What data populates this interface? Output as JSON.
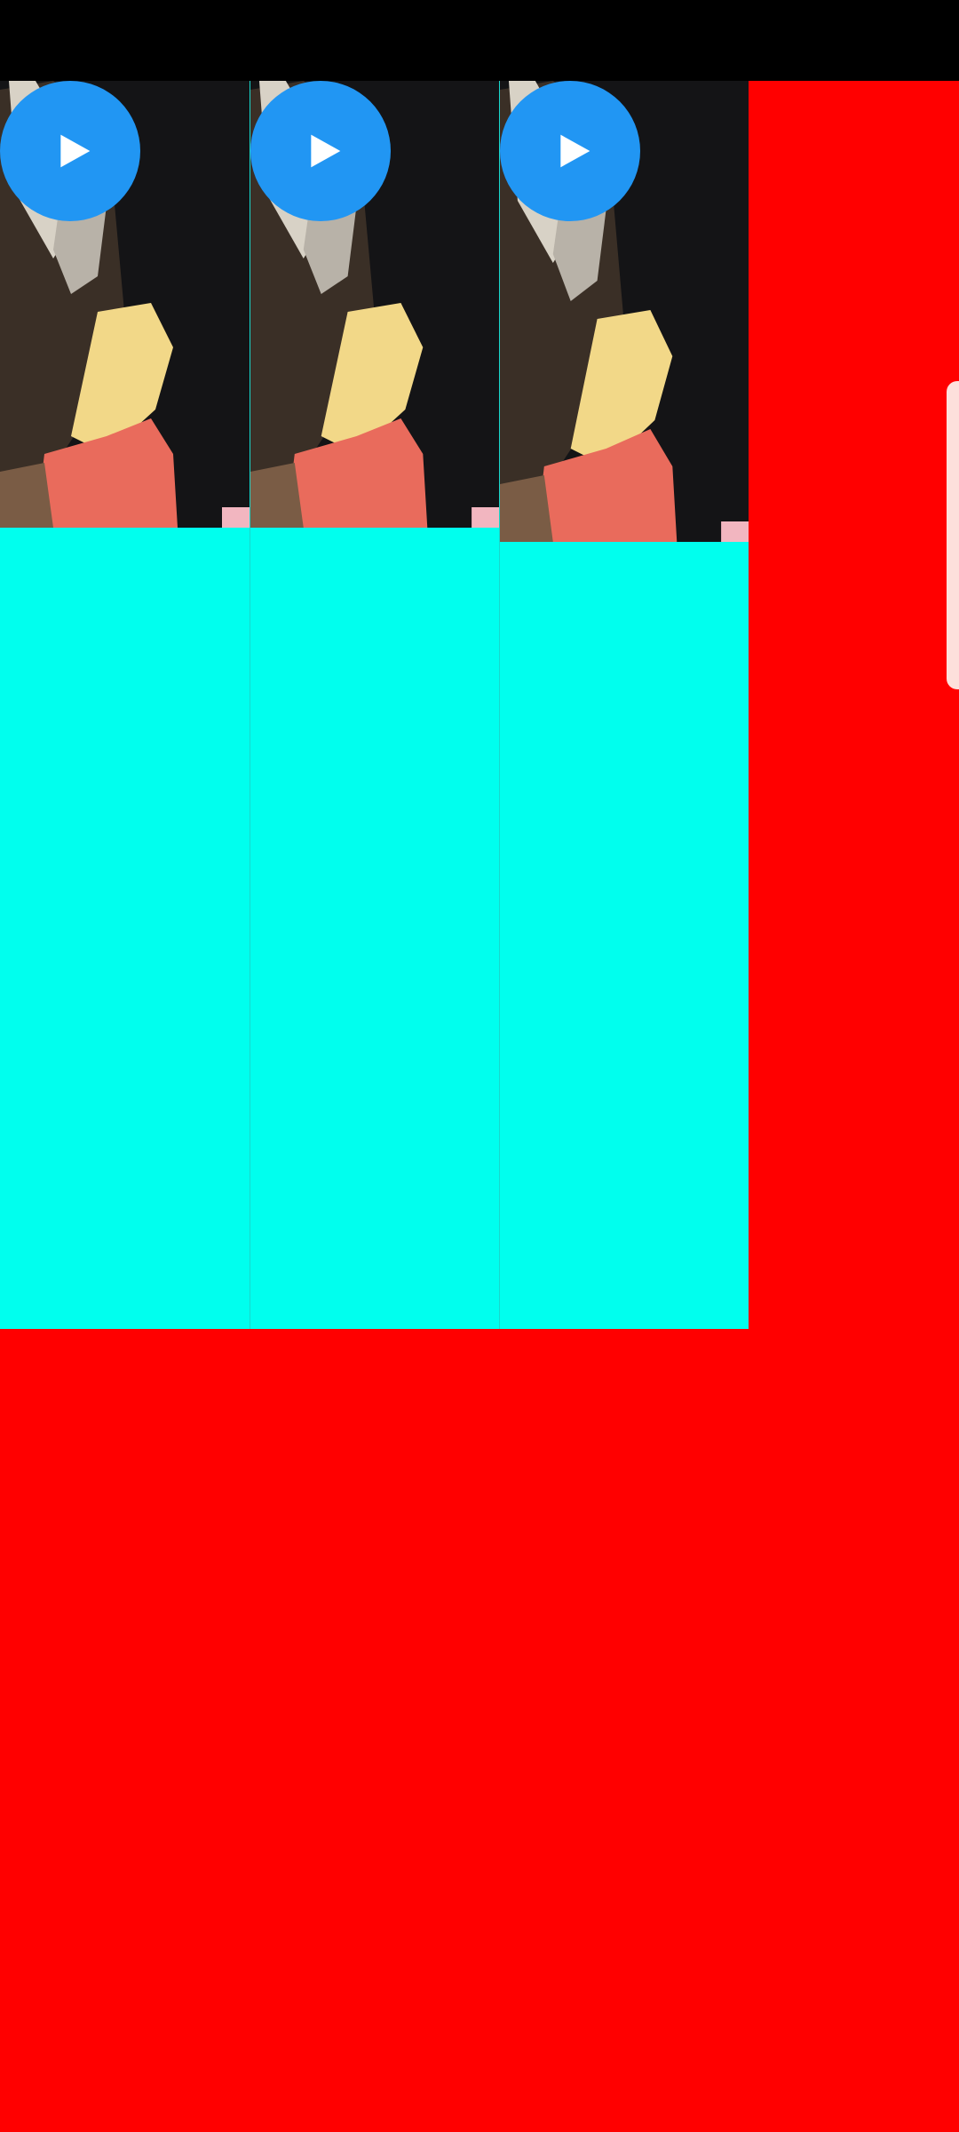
{
  "colors": {
    "status_bar": "#000000",
    "page_background": "#ff0000",
    "column_background": "#00ffee",
    "play_button": "#2196f3",
    "play_glyph": "#ffffff",
    "side_handle": "#fde0dc"
  },
  "icons": {
    "play": "play-icon"
  },
  "gallery": {
    "items": [
      {
        "thumbnail": "video-thumbnail",
        "play_icon": "play-icon"
      },
      {
        "thumbnail": "video-thumbnail",
        "play_icon": "play-icon"
      },
      {
        "thumbnail": "video-thumbnail",
        "play_icon": "play-icon"
      }
    ]
  }
}
